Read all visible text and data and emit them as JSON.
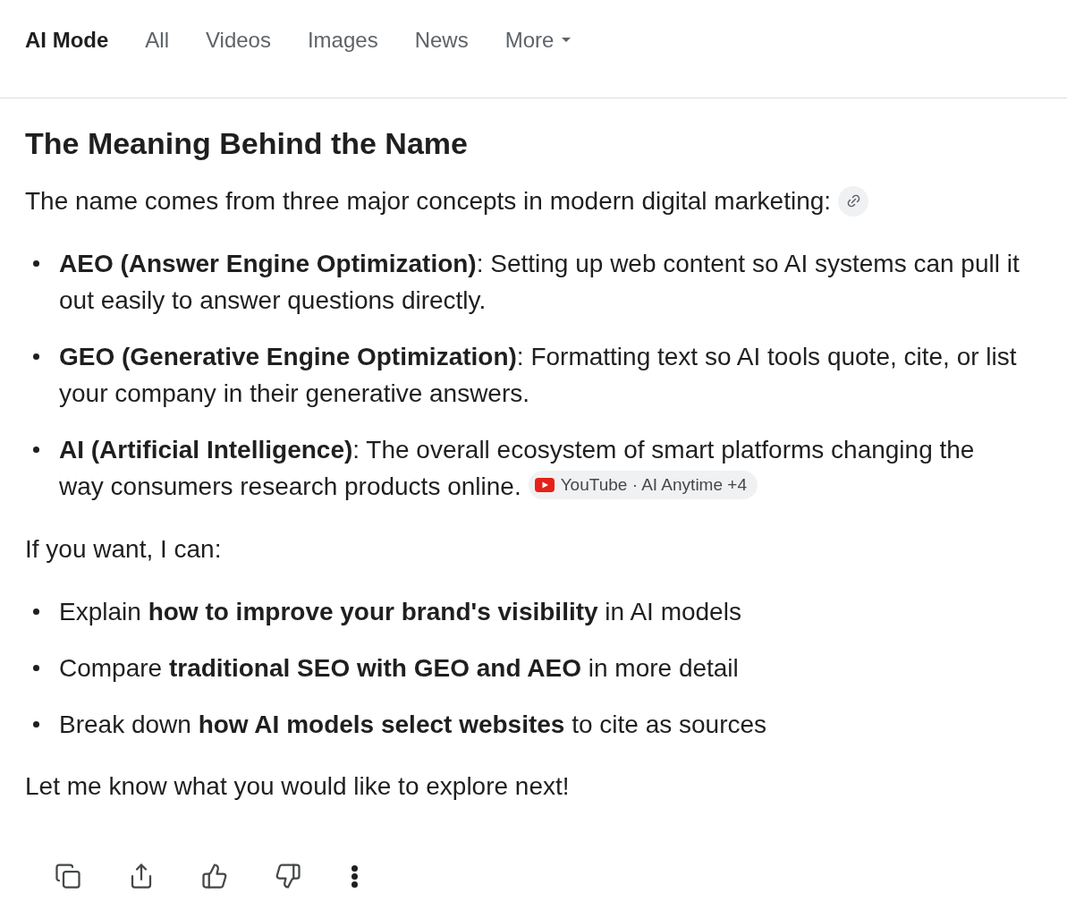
{
  "tabs": [
    {
      "label": "AI Mode",
      "selected": true,
      "kind": "tab"
    },
    {
      "label": "All",
      "selected": false,
      "kind": "tab"
    },
    {
      "label": "Videos",
      "selected": false,
      "kind": "tab"
    },
    {
      "label": "Images",
      "selected": false,
      "kind": "tab"
    },
    {
      "label": "News",
      "selected": false,
      "kind": "tab"
    },
    {
      "label": "More",
      "selected": false,
      "kind": "menu"
    }
  ],
  "answer": {
    "heading": "The Meaning Behind the Name",
    "intro": "The name comes from three major concepts in modern digital marketing:",
    "concepts": [
      {
        "text": "**AEO (Answer Engine Optimization)**: Setting up web content so AI systems can pull it out easily to answer questions directly."
      },
      {
        "text": "**GEO (Generative Engine Optimization)**: Formatting text so AI tools quote, cite, or list your company in their generative answers."
      },
      {
        "text": "**AI (Artificial Intelligence)**: The overall ecosystem of smart platforms changing the way consumers research products online.",
        "source_chip": "YouTube · AI Anytime +4"
      }
    ],
    "offer_intro": "If you want, I can:",
    "offers": [
      "Explain **how to improve your brand's visibility** in AI models",
      "Compare **traditional SEO with GEO and AEO** in more detail",
      "Break down **how AI models select websites** to cite as sources"
    ],
    "closing": "Let me know what you would like to explore next!"
  }
}
